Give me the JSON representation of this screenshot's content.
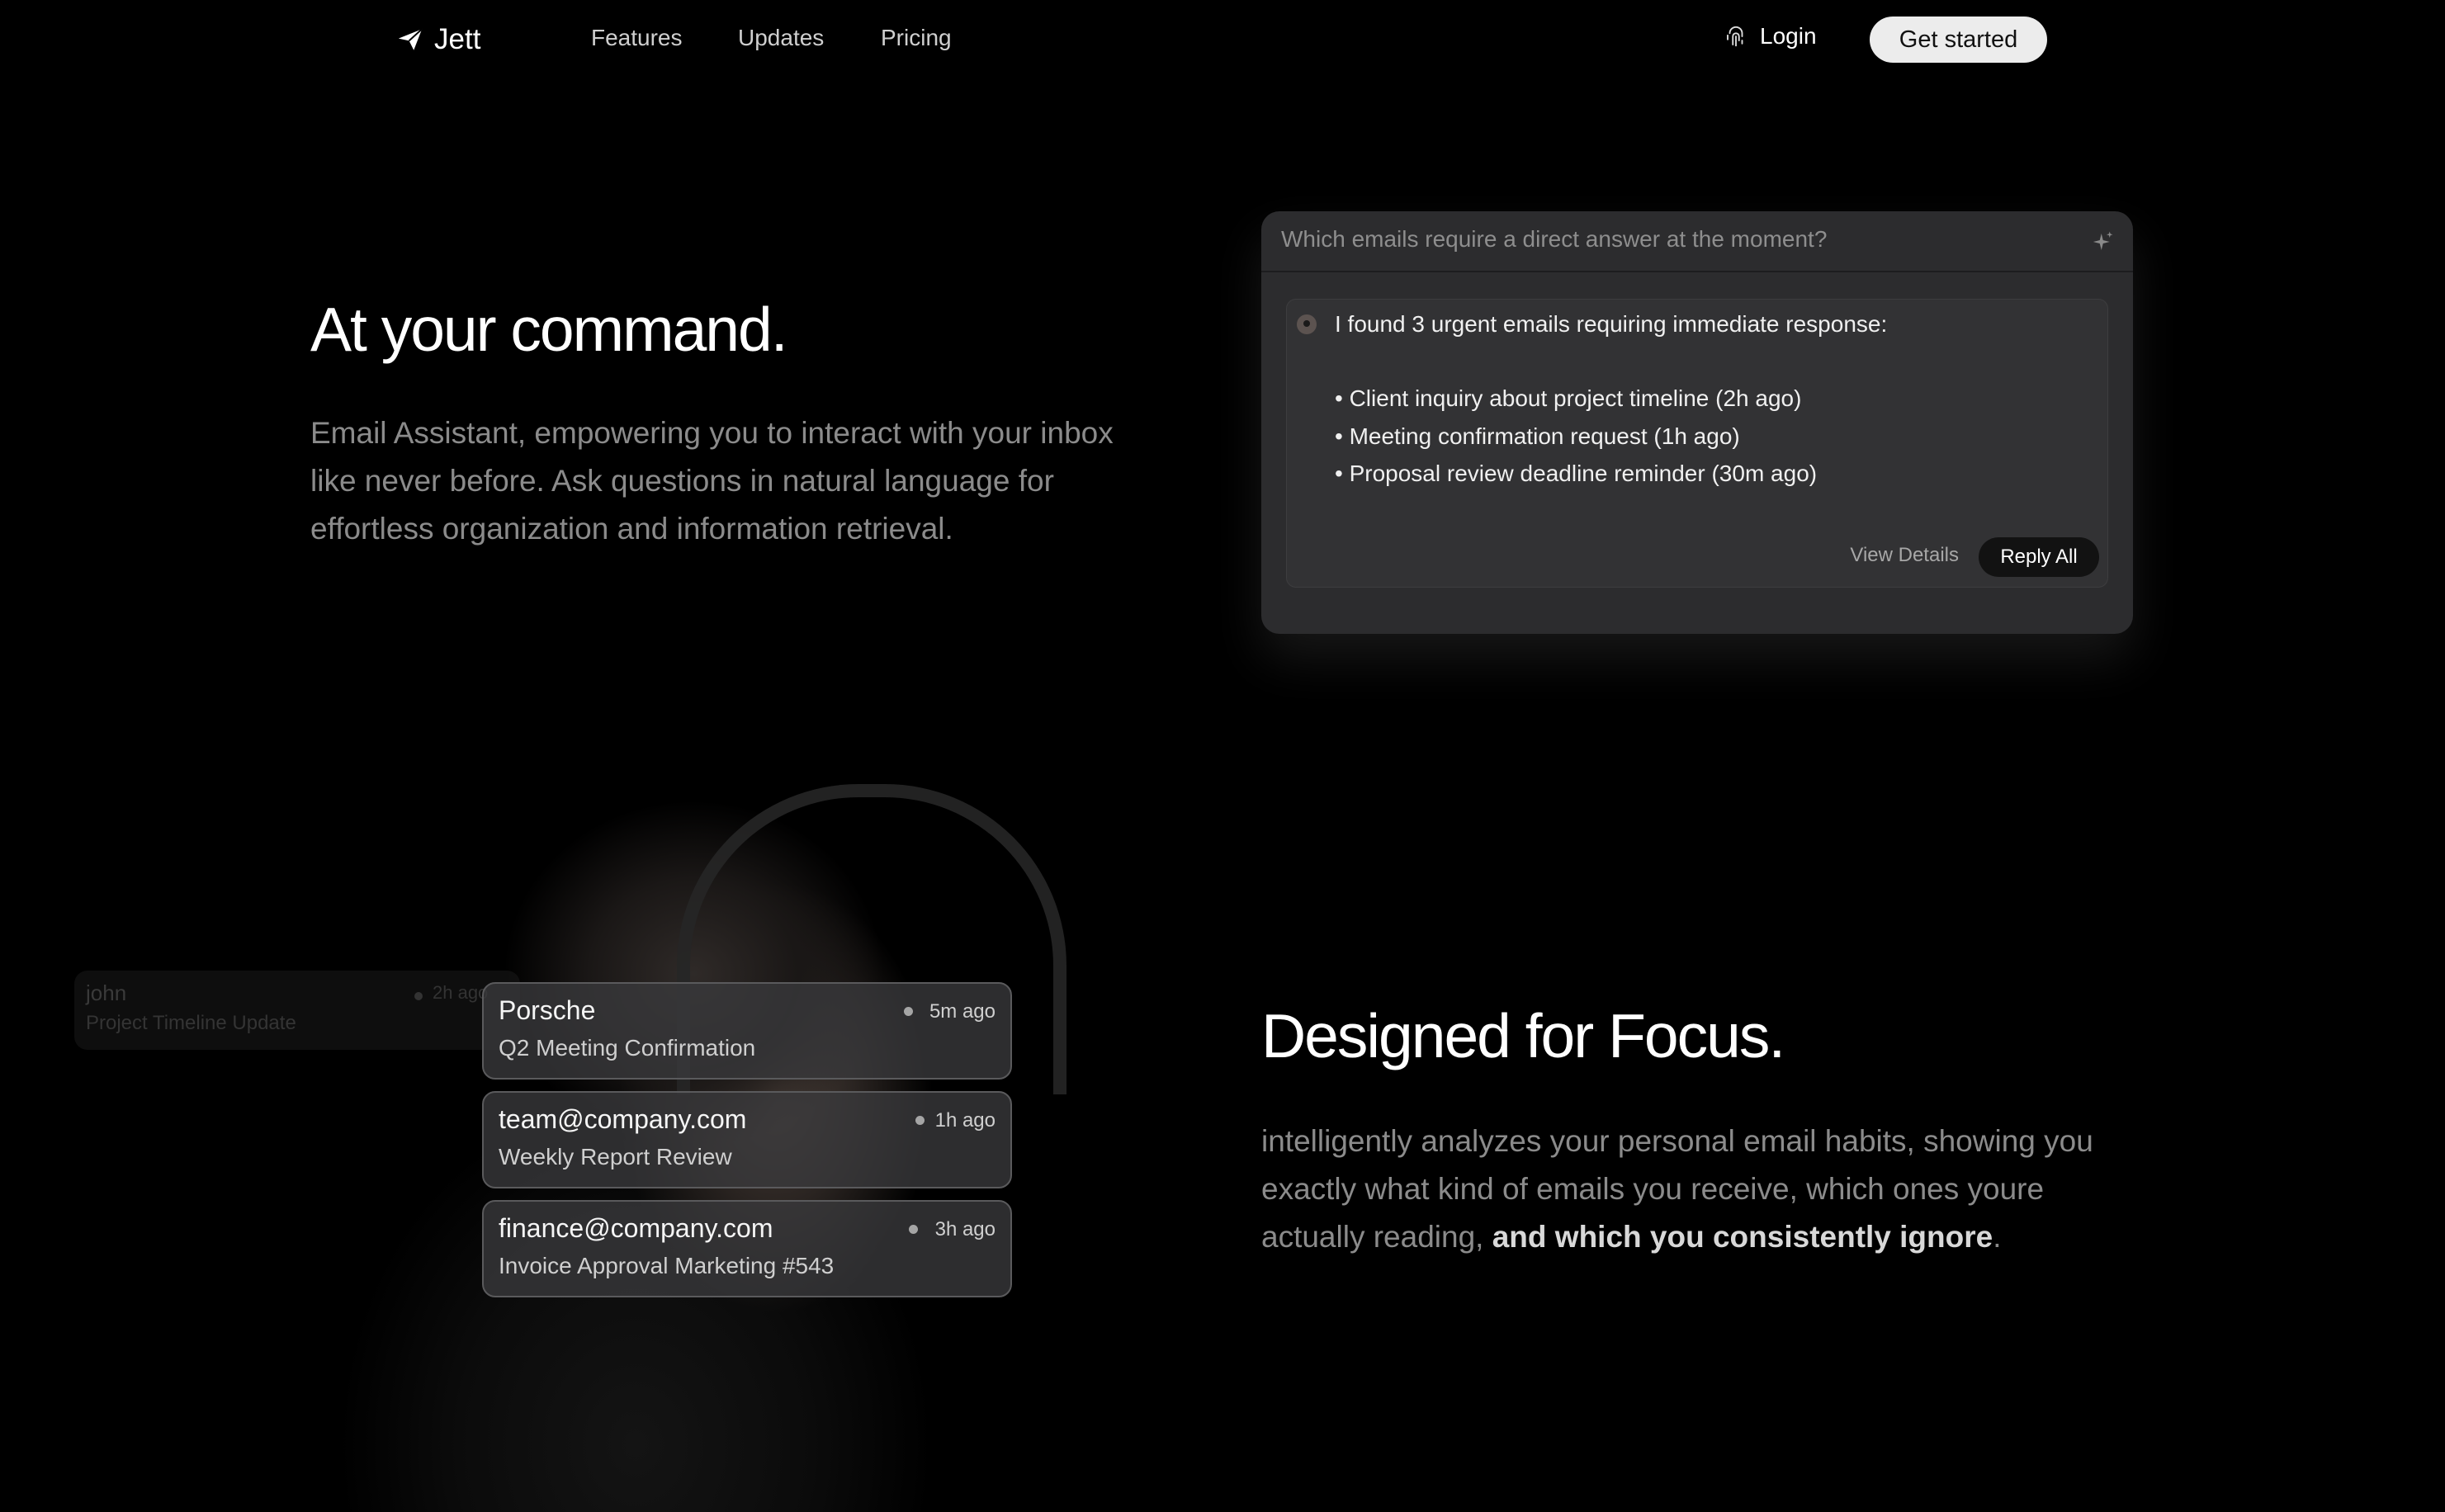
{
  "nav": {
    "logo": "Jett",
    "links": [
      "Features",
      "Updates",
      "Pricing"
    ],
    "login": "Login",
    "cta": "Get started"
  },
  "hero": {
    "title": "At your command.",
    "description": "Email Assistant, empowering you to interact with your inbox like never before. Ask questions in natural language for effortless organization and information retrieval."
  },
  "assistant": {
    "query_placeholder": "Which emails require a direct answer at the moment?",
    "response_heading": "I found 3 urgent emails requiring immediate response:",
    "items": [
      "• Client inquiry about project timeline (2h ago)",
      "• Meeting confirmation request (1h ago)",
      "• Proposal review deadline reminder (30m ago)"
    ],
    "view_details": "View Details",
    "reply_all": "Reply All"
  },
  "inbox_preview": {
    "ghost": {
      "from": "john",
      "subject": "Project Timeline Update",
      "time": "2h ago"
    },
    "emails": [
      {
        "from": "Porsche",
        "subject": "Q2 Meeting Confirmation",
        "time": "5m ago"
      },
      {
        "from": "team@company.com",
        "subject": "Weekly Report Review",
        "time": "1h ago"
      },
      {
        "from": "finance@company.com",
        "subject": "Invoice Approval Marketing #543",
        "time": "3h ago"
      }
    ]
  },
  "focus": {
    "title": "Designed for Focus.",
    "description": "intelligently analyzes your personal email habits, showing you exactly what kind of emails you receive, which ones youre actually reading, ",
    "emphasis": "and which you consistently ignore",
    "end": "."
  },
  "icons": {
    "logo": "paper-plane-icon",
    "login": "fingerprint-icon",
    "query": "sparkle-icon",
    "assistant": "assistant-avatar-icon"
  },
  "colors": {
    "background": "#000000",
    "panel": "#2c2c2e",
    "cta": "#ececec",
    "muted_text": "#8b8b8b"
  }
}
